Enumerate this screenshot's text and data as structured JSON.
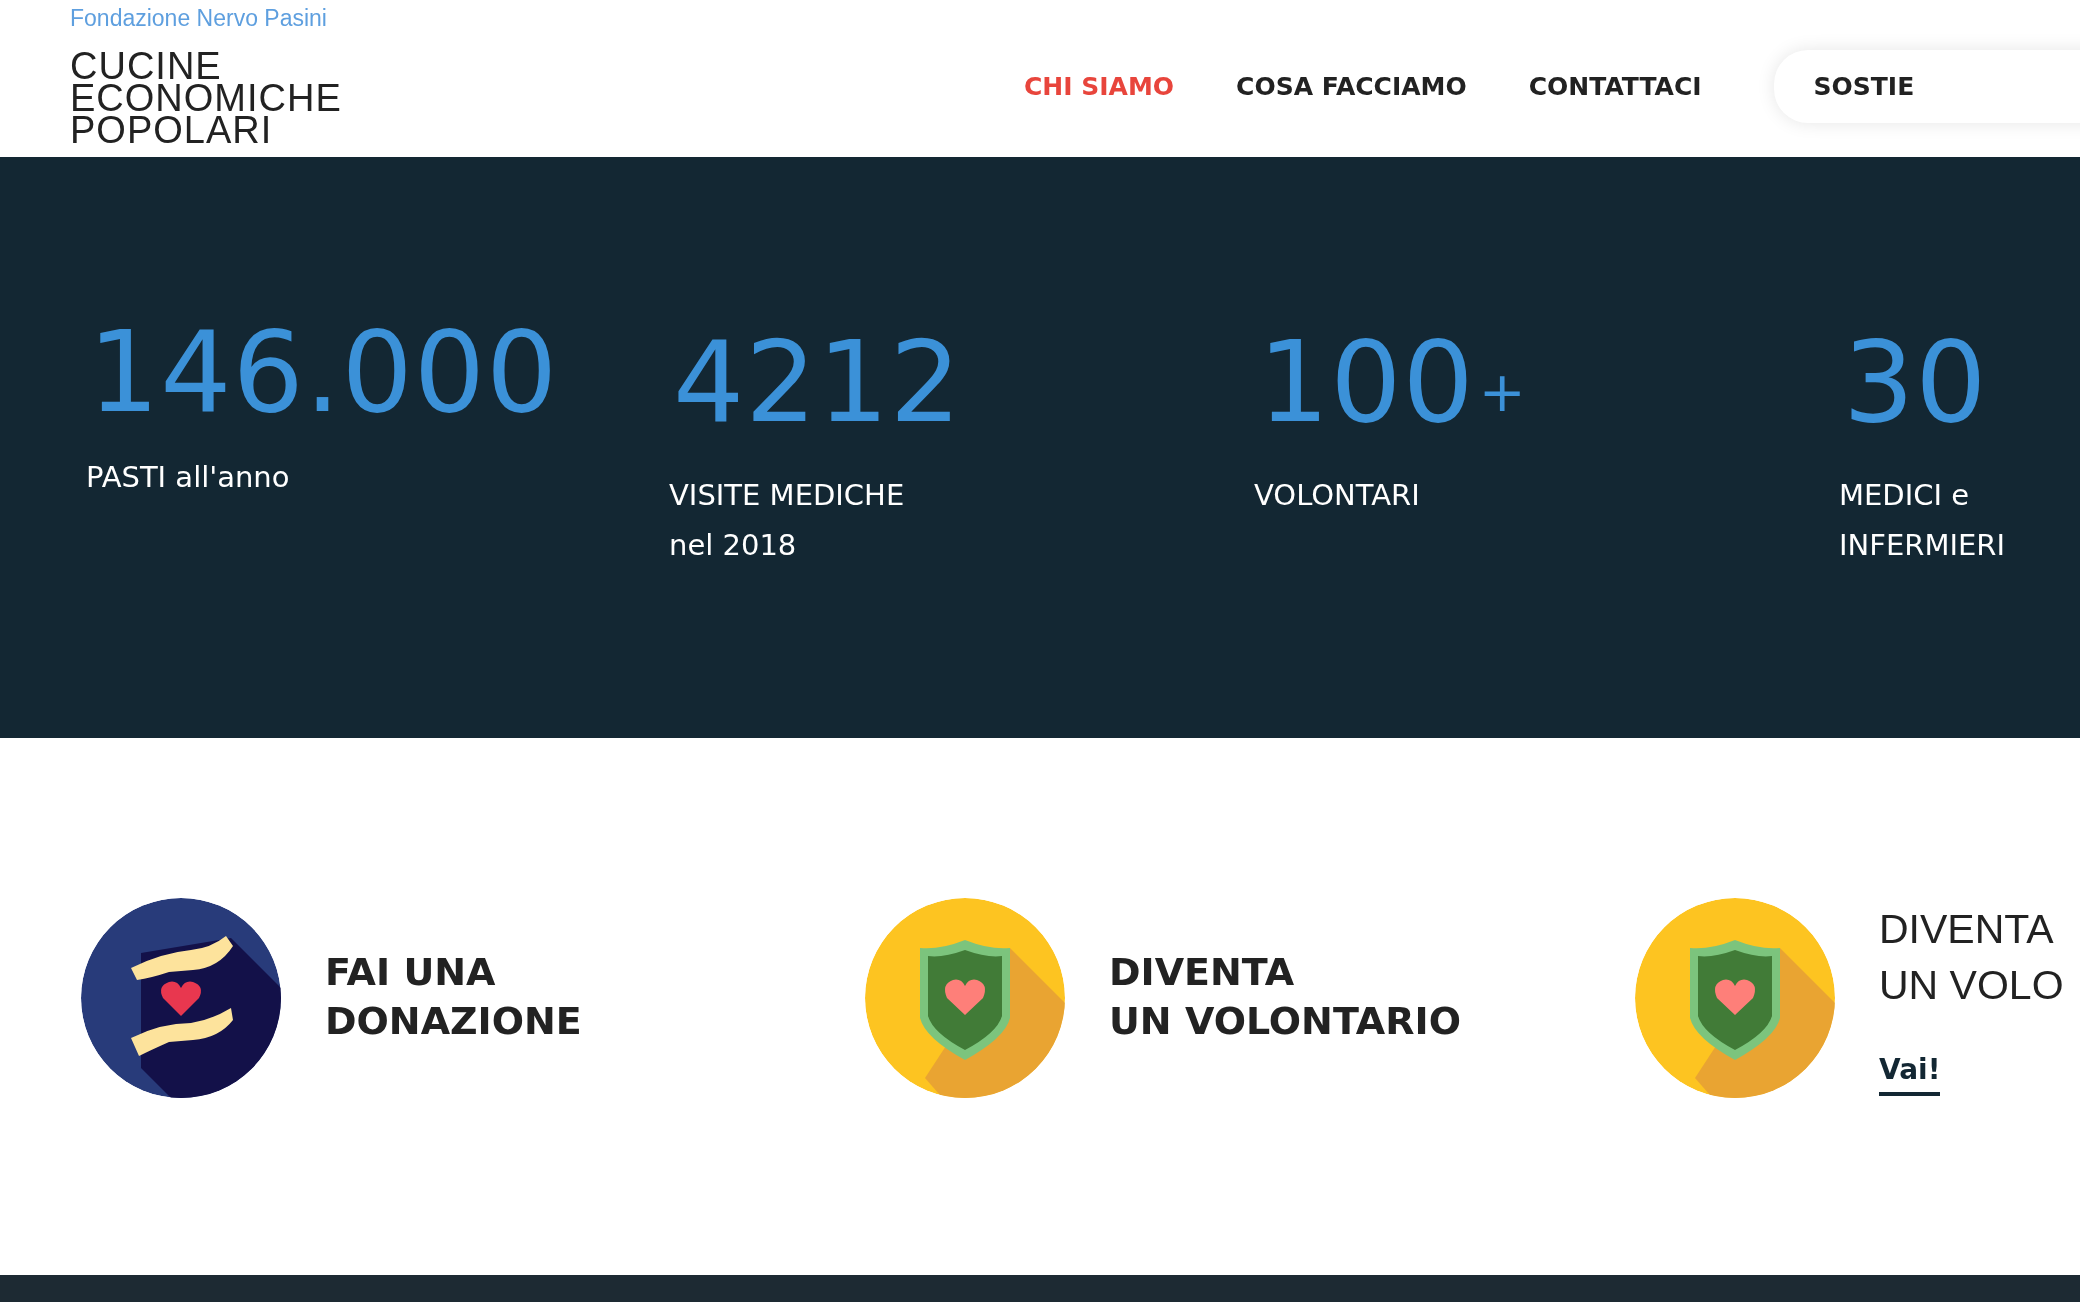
{
  "header": {
    "tagline": "Fondazione Nervo Pasini",
    "logo_lines": [
      "CUCINE",
      "ECONOMICHE",
      "POPOLARI"
    ],
    "nav": [
      {
        "label": "CHI SIAMO",
        "selected": true,
        "kind": "link"
      },
      {
        "label": "COSA FACCIAMO",
        "selected": false,
        "kind": "link"
      },
      {
        "label": "CONTATTACI",
        "selected": false,
        "kind": "link"
      },
      {
        "label": "SOSTIE",
        "selected": false,
        "kind": "pill"
      }
    ]
  },
  "stats": [
    {
      "number": "146.000",
      "label_lines": [
        "PASTI all'anno"
      ]
    },
    {
      "number": "4212",
      "label_lines": [
        "VISITE MEDICHE",
        "nel 2018"
      ]
    },
    {
      "number": "100",
      "suffix": "+",
      "label_lines": [
        "VOLONTARI"
      ]
    },
    {
      "number": "30",
      "label_lines": [
        "MEDICI e",
        "INFERMIERI"
      ]
    }
  ],
  "actions": [
    {
      "kind": "donate",
      "title_lines": [
        "FAI UNA",
        "DONAZIONE"
      ]
    },
    {
      "kind": "volunteer",
      "title_lines": [
        "DIVENTA",
        "UN VOLONTARIO"
      ]
    },
    {
      "kind": "volunteer",
      "title_lines": [
        "DIVENTA",
        "UN VOLO"
      ],
      "link": "Vai!"
    }
  ]
}
